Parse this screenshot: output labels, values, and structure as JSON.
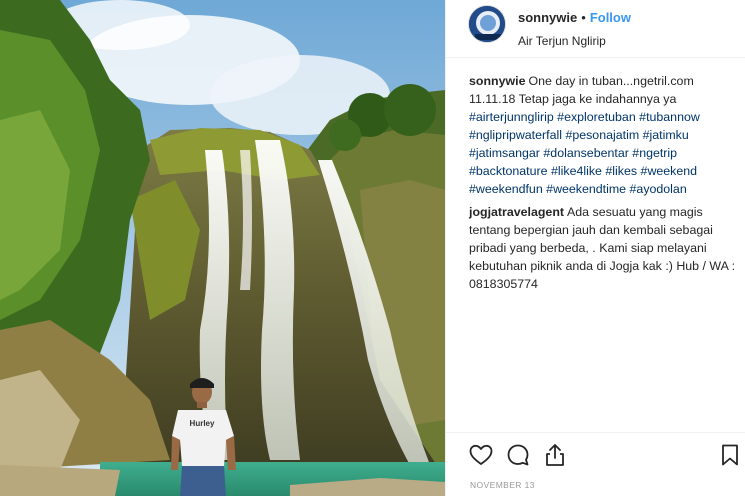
{
  "post": {
    "username": "sonnywie",
    "separator": "•",
    "follow_label": "Follow",
    "location": "Air Terjun Nglirip",
    "date": "NOVEMBER 13"
  },
  "comments": [
    {
      "user": "sonnywie",
      "line1": "One day in tuban...ngetril.com",
      "line2": "11.11.18 Tetap jaga ke indahannya ya",
      "hashtags": [
        "#airterjunnglirip",
        "#exploretuban",
        "#tubannow",
        "#nglipripwaterfall",
        "#pesonajatim",
        "#jatimku",
        "#jatimsangar",
        "#dolansebentar",
        "#ngetrip",
        "#backtonature",
        "#like4like",
        "#likes",
        "#weekend",
        "#weekendfun",
        "#weekendtime",
        "#ayodolan"
      ]
    },
    {
      "user": "jogjatravelagent",
      "text": "Ada sesuatu yang magis tentang bepergian jauh dan kembali sebagai pribadi yang berbeda, . Kami siap melayani kebutuhan piknik anda di Jogja kak :) Hub / WA : 0818305774"
    }
  ],
  "photo": {
    "shirt_brand": "Hurley"
  },
  "actions": {
    "icons": [
      "heart-icon",
      "comment-icon",
      "share-icon",
      "bookmark-icon"
    ]
  },
  "colors": {
    "link_blue": "#3897f0",
    "hashtag_blue": "#003569",
    "text": "#262626",
    "muted": "#999999",
    "divider": "#efefef"
  }
}
